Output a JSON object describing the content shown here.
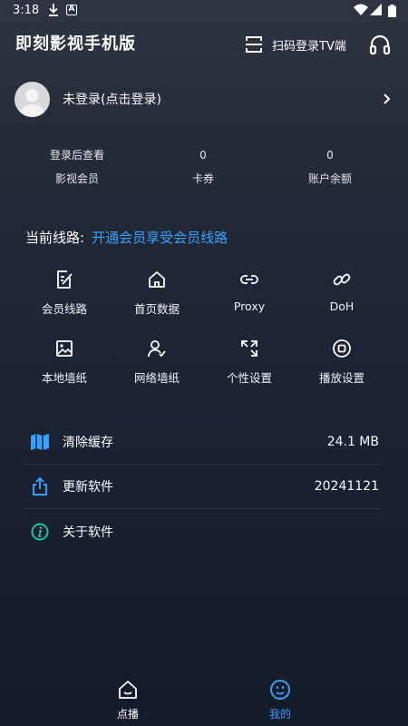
{
  "statusbar": {
    "time": "3:18",
    "a_glyph": "A"
  },
  "appbar": {
    "title": "即刻影视手机版",
    "scan_label": "扫码登录TV端"
  },
  "profile": {
    "login_text": "未登录(点击登录)"
  },
  "stats": [
    {
      "value": "登录后查看",
      "label": "影视会员"
    },
    {
      "value": "0",
      "label": "卡券"
    },
    {
      "value": "0",
      "label": "账户余额"
    }
  ],
  "route": {
    "label": "当前线路:",
    "link": "开通会员享受会员线路"
  },
  "grid": [
    {
      "label": "会员线路",
      "icon": "edit-doc-icon"
    },
    {
      "label": "首页数据",
      "icon": "home-icon"
    },
    {
      "label": "Proxy",
      "icon": "link-icon"
    },
    {
      "label": "DoH",
      "icon": "chain-icon"
    },
    {
      "label": "本地墙纸",
      "icon": "image-icon"
    },
    {
      "label": "网络墙纸",
      "icon": "user-check-icon"
    },
    {
      "label": "个性设置",
      "icon": "expand-icon"
    },
    {
      "label": "播放设置",
      "icon": "record-icon"
    }
  ],
  "list": [
    {
      "label": "清除缓存",
      "value": "24.1 MB",
      "icon": "map-icon"
    },
    {
      "label": "更新软件",
      "value": "20241121",
      "icon": "share-icon"
    },
    {
      "label": "关于软件",
      "value": "",
      "icon": "info-icon"
    }
  ],
  "tabs": [
    {
      "label": "点播",
      "icon": "home-smile-icon",
      "active": false
    },
    {
      "label": "我的",
      "icon": "smile-face-icon",
      "active": true
    }
  ],
  "colors": {
    "accent": "#3aa0ff",
    "text": "#ffffff",
    "divider": "#2f3848"
  }
}
